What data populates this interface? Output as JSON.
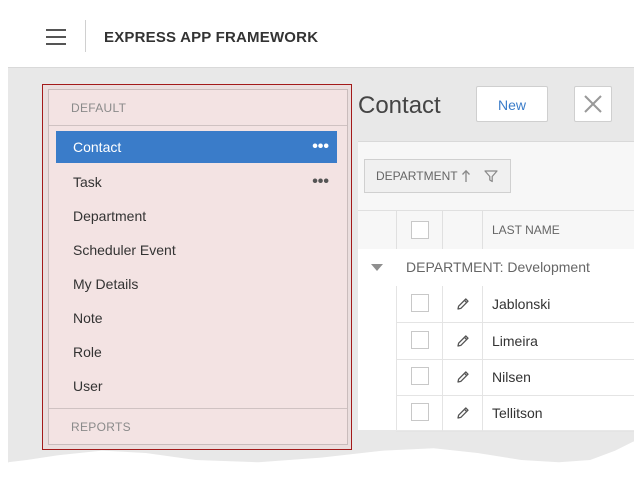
{
  "header": {
    "menu_icon": "hamburger-menu-icon",
    "app_title": "EXPRESS APP FRAMEWORK"
  },
  "sidebar": {
    "groups": [
      {
        "label": "DEFAULT",
        "items": [
          {
            "label": "Contact",
            "selected": true,
            "has_more": true
          },
          {
            "label": "Task",
            "selected": false,
            "has_more": true
          },
          {
            "label": "Department",
            "selected": false,
            "has_more": false
          },
          {
            "label": "Scheduler Event",
            "selected": false,
            "has_more": false
          },
          {
            "label": "My Details",
            "selected": false,
            "has_more": false
          },
          {
            "label": "Note",
            "selected": false,
            "has_more": false
          },
          {
            "label": "Role",
            "selected": false,
            "has_more": false
          },
          {
            "label": "User",
            "selected": false,
            "has_more": false
          }
        ]
      },
      {
        "label": "REPORTS",
        "items": []
      }
    ],
    "more_glyph": "•••",
    "selected_color": "#3a7cc9"
  },
  "main": {
    "title": "Contact",
    "new_button": "New",
    "close_icon": "close-icon",
    "group_chip": {
      "label": "DEPARTMENT",
      "sort_icon": "sort-ascending-icon",
      "filter_icon": "filter-icon"
    },
    "columns": {
      "last_name": "LAST NAME"
    },
    "group_row": "DEPARTMENT: Development",
    "rows": [
      {
        "last_name": "Jablonski"
      },
      {
        "last_name": "Limeira"
      },
      {
        "last_name": "Nilsen"
      },
      {
        "last_name": "Tellitson"
      }
    ],
    "accent_color": "#3a7cc9"
  }
}
